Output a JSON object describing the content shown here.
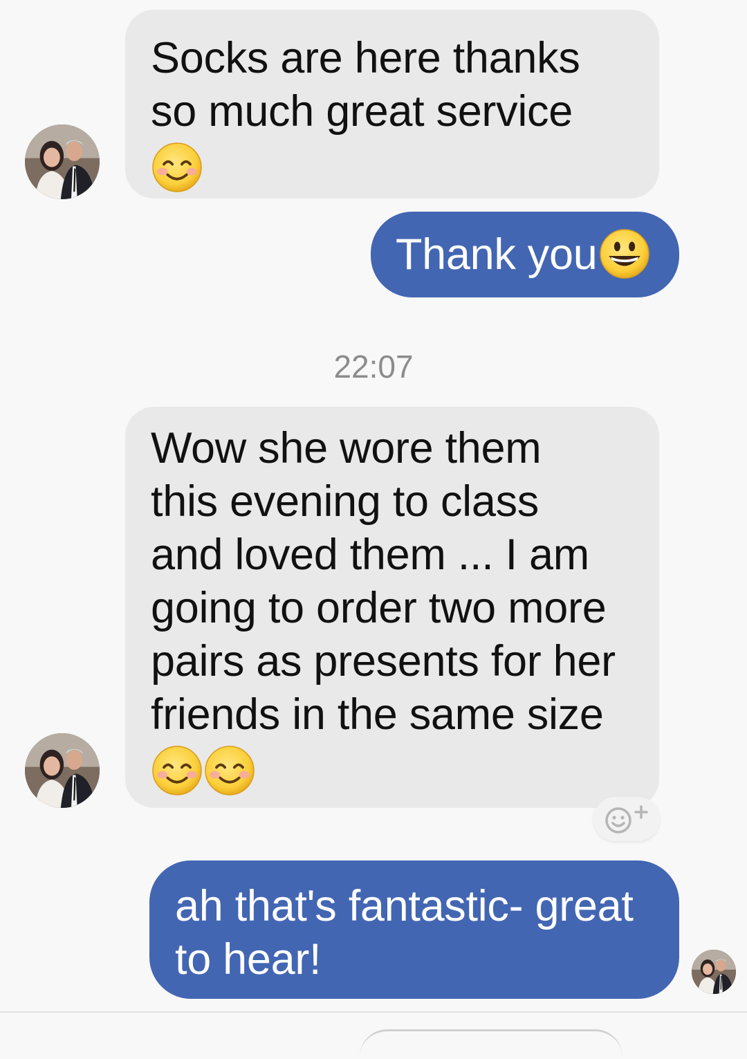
{
  "conversation": {
    "messages": [
      {
        "direction": "incoming",
        "lines": [
          "Socks are here thanks",
          "so much great service"
        ],
        "emoji": [
          "smiling-face-with-smiling-eyes"
        ]
      },
      {
        "direction": "outgoing",
        "text": "Thank you",
        "emoji": [
          "grinning-face-with-big-eyes"
        ]
      },
      {
        "direction": "incoming",
        "lines": [
          "Wow she wore them",
          "this evening to class",
          "and loved them ... I am",
          "going to order two more",
          "pairs as presents for her",
          "friends in the same size"
        ],
        "emoji": [
          "smiling-face-with-smiling-eyes",
          "smiling-face-with-smiling-eyes"
        ]
      },
      {
        "direction": "outgoing",
        "lines": [
          "ah that's fantastic- great",
          "to hear!"
        ]
      }
    ],
    "timestamp": "22:07",
    "colors": {
      "outgoing_bubble": "#4366b3",
      "incoming_bubble": "#e9e9e9",
      "background": "#f8f8f8",
      "timestamp_text": "#8c8c8c"
    }
  }
}
